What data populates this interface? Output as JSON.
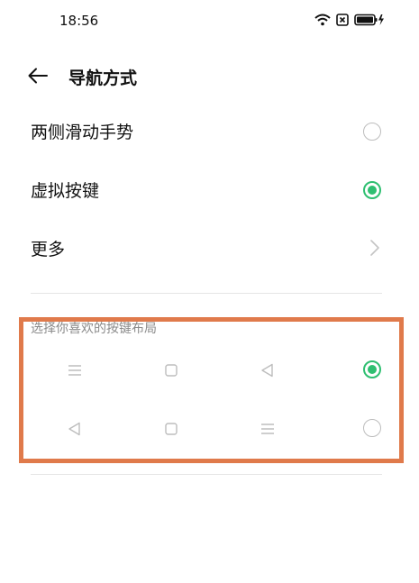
{
  "status_bar": {
    "time": "18:56",
    "icons": [
      "wifi-icon",
      "sim-x-icon",
      "battery-charging-icon"
    ]
  },
  "header": {
    "back_icon": "arrow-left-icon",
    "title": "导航方式"
  },
  "options": [
    {
      "label": "两侧滑动手势",
      "selected": false
    },
    {
      "label": "虚拟按键",
      "selected": true
    },
    {
      "label": "更多",
      "type": "chevron"
    }
  ],
  "layout_section": {
    "label": "选择你喜欢的按键布局",
    "layouts": [
      {
        "keys": [
          "menu-icon",
          "home-square-icon",
          "back-triangle-icon"
        ],
        "selected": true
      },
      {
        "keys": [
          "back-triangle-icon",
          "home-square-icon",
          "menu-icon"
        ],
        "selected": false
      }
    ]
  },
  "colors": {
    "accent": "#2fbf71",
    "highlight_border": "#e07a4b",
    "icon_gray": "#bdbdbd"
  }
}
